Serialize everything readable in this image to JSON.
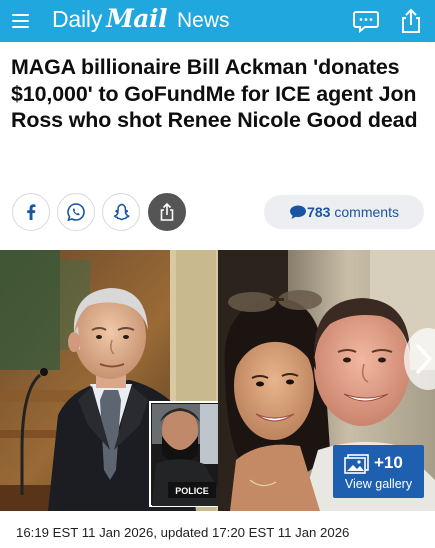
{
  "header": {
    "brand_daily": "Daily",
    "brand_mail": "Mail",
    "section": "News",
    "color": "#1fa7de"
  },
  "article": {
    "headline": "MAGA billionaire Bill Ackman 'donates $10,000' to GoFundMe for ICE agent Jon Ross who shot Renee Nicole Good dead",
    "timestamp": "16:19 EST 11 Jan 2026, updated 17:20 EST 11 Jan 2026"
  },
  "share": {
    "buttons": [
      "facebook-icon",
      "whatsapp-icon",
      "snapchat-icon",
      "share-icon"
    ],
    "comments_count": "783",
    "comments_label": "comments"
  },
  "gallery": {
    "extra_count": "+10",
    "label": "View gallery",
    "inset_text": "POLICE"
  }
}
